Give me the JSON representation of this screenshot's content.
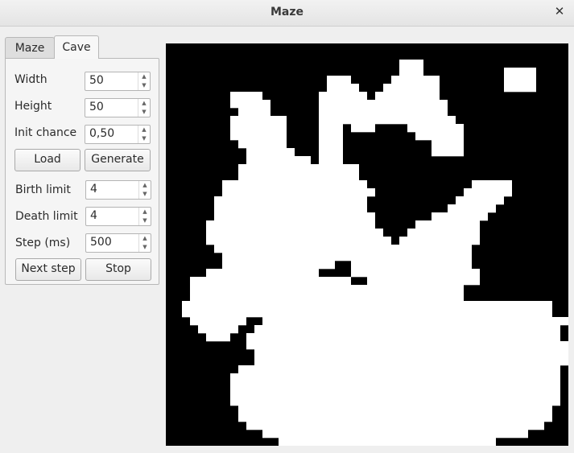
{
  "window": {
    "title": "Maze",
    "close_glyph": "✕"
  },
  "tabs": [
    {
      "label": "Maze",
      "active": false
    },
    {
      "label": "Cave",
      "active": true
    }
  ],
  "cave": {
    "width_label": "Width",
    "width_value": "50",
    "height_label": "Height",
    "height_value": "50",
    "init_label": "Init chance",
    "init_value": "0,50",
    "load_label": "Load",
    "generate_label": "Generate",
    "birth_label": "Birth limit",
    "birth_value": "4",
    "death_label": "Death limit",
    "death_value": "4",
    "step_label": "Step (ms)",
    "step_value": "500",
    "next_label": "Next step",
    "stop_label": "Stop"
  },
  "grid": {
    "cols": 50,
    "rows": 50,
    "wall_color": "#000000",
    "floor_color": "#ffffff",
    "floor_runs": [
      [],
      [],
      [
        {
          "start": 29,
          "end": 31
        }
      ],
      [
        {
          "start": 29,
          "end": 31
        },
        {
          "start": 42,
          "end": 45
        }
      ],
      [
        {
          "start": 20,
          "end": 22
        },
        {
          "start": 28,
          "end": 33
        },
        {
          "start": 42,
          "end": 45
        }
      ],
      [
        {
          "start": 20,
          "end": 23
        },
        {
          "start": 27,
          "end": 33
        },
        {
          "start": 42,
          "end": 45
        }
      ],
      [
        {
          "start": 8,
          "end": 11
        },
        {
          "start": 19,
          "end": 24
        },
        {
          "start": 26,
          "end": 33
        }
      ],
      [
        {
          "start": 8,
          "end": 12
        },
        {
          "start": 19,
          "end": 34
        }
      ],
      [
        {
          "start": 9,
          "end": 12
        },
        {
          "start": 19,
          "end": 34
        }
      ],
      [
        {
          "start": 8,
          "end": 14
        },
        {
          "start": 19,
          "end": 35
        }
      ],
      [
        {
          "start": 8,
          "end": 14
        },
        {
          "start": 19,
          "end": 21
        },
        {
          "start": 23,
          "end": 25
        },
        {
          "start": 30,
          "end": 36
        }
      ],
      [
        {
          "start": 8,
          "end": 14
        },
        {
          "start": 19,
          "end": 21
        },
        {
          "start": 31,
          "end": 36
        }
      ],
      [
        {
          "start": 9,
          "end": 14
        },
        {
          "start": 19,
          "end": 21
        },
        {
          "start": 33,
          "end": 36
        }
      ],
      [
        {
          "start": 10,
          "end": 15
        },
        {
          "start": 19,
          "end": 21
        },
        {
          "start": 33,
          "end": 36
        }
      ],
      [
        {
          "start": 10,
          "end": 17
        },
        {
          "start": 19,
          "end": 21
        }
      ],
      [
        {
          "start": 9,
          "end": 23
        }
      ],
      [
        {
          "start": 9,
          "end": 23
        }
      ],
      [
        {
          "start": 7,
          "end": 24
        },
        {
          "start": 38,
          "end": 42
        }
      ],
      [
        {
          "start": 7,
          "end": 25
        },
        {
          "start": 37,
          "end": 42
        }
      ],
      [
        {
          "start": 6,
          "end": 24
        },
        {
          "start": 36,
          "end": 41
        }
      ],
      [
        {
          "start": 6,
          "end": 24
        },
        {
          "start": 35,
          "end": 40
        }
      ],
      [
        {
          "start": 6,
          "end": 25
        },
        {
          "start": 33,
          "end": 39
        }
      ],
      [
        {
          "start": 5,
          "end": 25
        },
        {
          "start": 31,
          "end": 38
        }
      ],
      [
        {
          "start": 5,
          "end": 26
        },
        {
          "start": 30,
          "end": 38
        }
      ],
      [
        {
          "start": 5,
          "end": 27
        },
        {
          "start": 29,
          "end": 38
        }
      ],
      [
        {
          "start": 6,
          "end": 37
        }
      ],
      [
        {
          "start": 7,
          "end": 37
        }
      ],
      [
        {
          "start": 7,
          "end": 20
        },
        {
          "start": 23,
          "end": 37
        }
      ],
      [
        {
          "start": 5,
          "end": 18
        },
        {
          "start": 23,
          "end": 38
        }
      ],
      [
        {
          "start": 3,
          "end": 22
        },
        {
          "start": 25,
          "end": 38
        }
      ],
      [
        {
          "start": 3,
          "end": 36
        }
      ],
      [
        {
          "start": 3,
          "end": 36
        }
      ],
      [
        {
          "start": 2,
          "end": 47
        }
      ],
      [
        {
          "start": 2,
          "end": 47
        }
      ],
      [
        {
          "start": 3,
          "end": 9
        },
        {
          "start": 12,
          "end": 49
        }
      ],
      [
        {
          "start": 4,
          "end": 8
        },
        {
          "start": 11,
          "end": 48
        }
      ],
      [
        {
          "start": 5,
          "end": 7
        },
        {
          "start": 10,
          "end": 48
        }
      ],
      [
        {
          "start": 10,
          "end": 49
        }
      ],
      [
        {
          "start": 11,
          "end": 49
        }
      ],
      [
        {
          "start": 11,
          "end": 49
        }
      ],
      [
        {
          "start": 9,
          "end": 48
        }
      ],
      [
        {
          "start": 8,
          "end": 48
        }
      ],
      [
        {
          "start": 8,
          "end": 48
        }
      ],
      [
        {
          "start": 8,
          "end": 48
        }
      ],
      [
        {
          "start": 8,
          "end": 48
        }
      ],
      [
        {
          "start": 9,
          "end": 47
        }
      ],
      [
        {
          "start": 9,
          "end": 47
        }
      ],
      [
        {
          "start": 10,
          "end": 46
        }
      ],
      [
        {
          "start": 12,
          "end": 44
        }
      ],
      [
        {
          "start": 14,
          "end": 40
        }
      ]
    ]
  }
}
